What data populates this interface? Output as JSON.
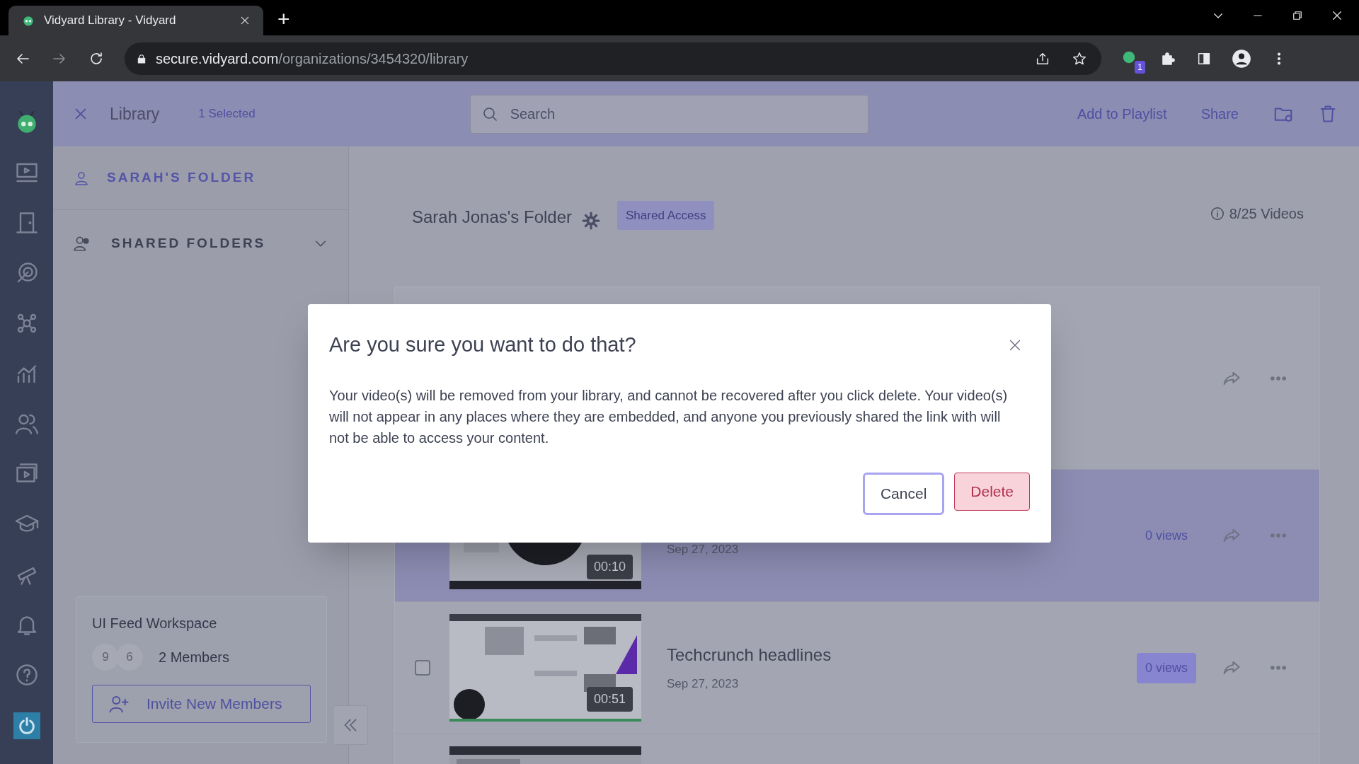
{
  "browser": {
    "tab_title": "Vidyard Library - Vidyard",
    "new_tab": "+",
    "url_host": "secure.vidyard.com",
    "url_path": "/organizations/3454320/library",
    "extension_badge": "1"
  },
  "header": {
    "title": "Library",
    "selection": "1 Selected",
    "search": {
      "placeholder": "Search"
    },
    "actions": [
      "Add to Playlist",
      "Share"
    ]
  },
  "sidebar": {
    "my_folder": "SARAH'S FOLDER",
    "shared_folders": {
      "label": "SHARED FOLDERS",
      "expanded": false
    },
    "workspace": {
      "name": "UI Feed Workspace",
      "avatars": [
        "9",
        "6"
      ],
      "members": "2 Members",
      "invite": "Invite New Members"
    }
  },
  "folder": {
    "title": "Sarah Jonas's Folder",
    "badge": "Shared Access",
    "count": "8/25 Videos"
  },
  "videos": [
    {
      "kind": "covered",
      "selected": false
    },
    {
      "kind": "video",
      "selected": true,
      "duration": "00:10",
      "date": "Sep 27, 2023",
      "views": "0 views",
      "highlighted": false
    },
    {
      "kind": "video",
      "selected": false,
      "title": "Techcrunch headlines",
      "date": "Sep 27, 2023",
      "duration": "00:51",
      "views": "0 views",
      "highlighted": true
    },
    {
      "kind": "cut",
      "selected": false
    }
  ],
  "dialog": {
    "title": "Are you sure you want to do that?",
    "message": "Your video(s) will be removed from your library, and cannot be recovered after you click delete. Your video(s) will not appear in any places where they are embedded, and anyone you previously shared the link with will not be able to access your content.",
    "buttons": [
      {
        "label": "Cancel",
        "kind": "secondary"
      },
      {
        "label": "Delete",
        "kind": "danger"
      }
    ]
  }
}
